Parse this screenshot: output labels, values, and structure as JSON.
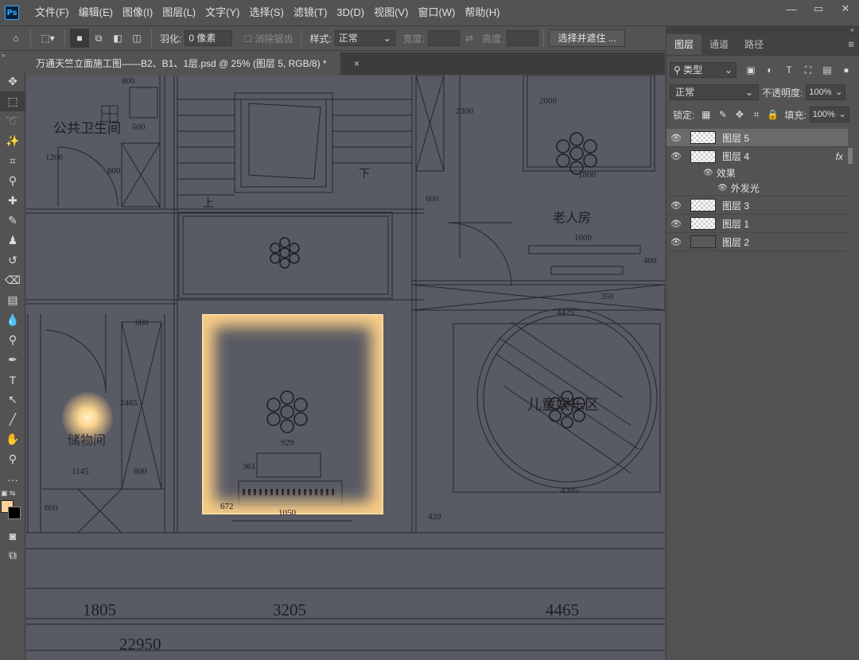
{
  "menubar": {
    "logo": "Ps",
    "items": [
      "文件(F)",
      "编辑(E)",
      "图像(I)",
      "图层(L)",
      "文字(Y)",
      "选择(S)",
      "滤镜(T)",
      "3D(D)",
      "视图(V)",
      "窗口(W)",
      "帮助(H)"
    ],
    "window_controls": [
      "minimize-icon",
      "restore-icon",
      "close-icon"
    ]
  },
  "options": {
    "feather_label": "羽化:",
    "feather_value": "0 像素",
    "antialias_label": "消除锯齿",
    "style_label": "样式:",
    "style_value": "正常",
    "width_label": "宽度:",
    "height_label": "高度:",
    "select_mask_button": "选择并遮住 ..."
  },
  "document": {
    "tab_title": "万通天竺立面施工图——B2、B1、1层.psd @ 25% (图层 5, RGB/8) *",
    "close": "×"
  },
  "canvas_labels": {
    "public_bathroom": "公共卫生间",
    "storage_room": "储物间",
    "elder_room": "老人房",
    "kids_area": "儿童娱乐区",
    "up": "上",
    "down": "下"
  },
  "canvas_dims": {
    "d800a": "800",
    "d500": "500",
    "d1200": "1200",
    "d800b": "800",
    "d2300": "2300",
    "d2000": "2000",
    "d1800": "1800",
    "d600a": "600",
    "d1600": "1600",
    "d400": "400",
    "d350": "350",
    "d4425": "4425",
    "d600b": "600",
    "d2465": "2465",
    "d1145": "1145",
    "d600c": "600",
    "d600d": "600",
    "d929": "929",
    "d361": "361",
    "d672": "672",
    "d1050": "1050",
    "d420": "420",
    "d4305": "4305",
    "b1805": "1805",
    "b3205": "3205",
    "b4465": "4465",
    "b22950": "22950"
  },
  "layers_panel": {
    "tabs": [
      "图层",
      "通道",
      "路径"
    ],
    "filter_kind": "类型",
    "blend_mode": "正常",
    "opacity_label": "不透明度:",
    "opacity_value": "100%",
    "lock_label": "锁定:",
    "fill_label": "填充:",
    "fill_value": "100%",
    "layers": [
      {
        "name": "图层 5",
        "selected": true
      },
      {
        "name": "图层 4",
        "fx": "fx"
      },
      {
        "name": "效果",
        "sub": true
      },
      {
        "name": "外发光",
        "sub": true
      },
      {
        "name": "图层 3"
      },
      {
        "name": "图层 1"
      },
      {
        "name": "图层 2"
      }
    ]
  },
  "colors": {
    "foreground": "#fcd19a",
    "background": "#000000",
    "glow": "#f8cc86",
    "canvas_bg": "#585a64"
  }
}
